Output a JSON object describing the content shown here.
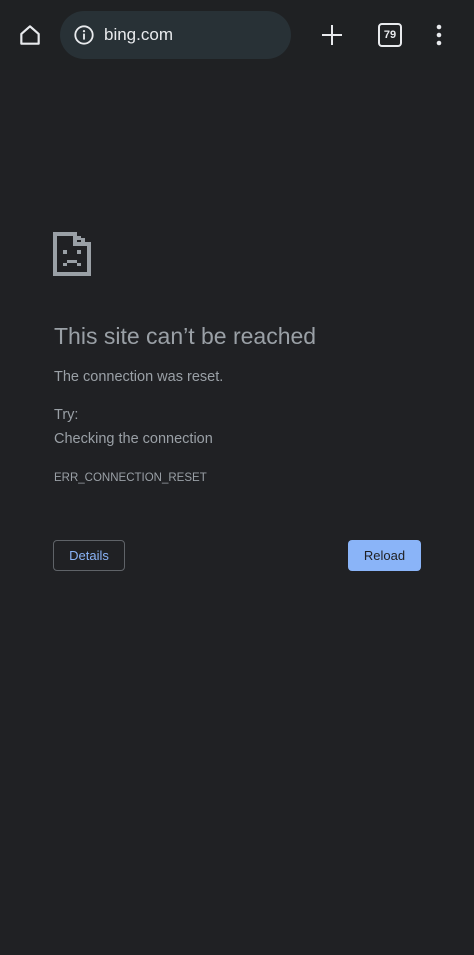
{
  "toolbar": {
    "home_icon": "home-icon",
    "info_icon": "info-icon",
    "url": "bing.com",
    "new_tab_icon": "plus-icon",
    "tab_count": "79",
    "menu_icon": "more-vert-icon"
  },
  "error_page": {
    "icon": "sad-page-icon",
    "title": "This site can’t be reached",
    "subtitle": "The connection was reset.",
    "try_label": "Try:",
    "suggestion": "Checking the connection",
    "error_code": "ERR_CONNECTION_RESET",
    "details_label": "Details",
    "reload_label": "Reload"
  },
  "colors": {
    "background": "#202124",
    "toolbar": "#1f2123",
    "omnibox": "#283136",
    "text": "#9aa0a6",
    "accent": "#8ab4f8"
  }
}
